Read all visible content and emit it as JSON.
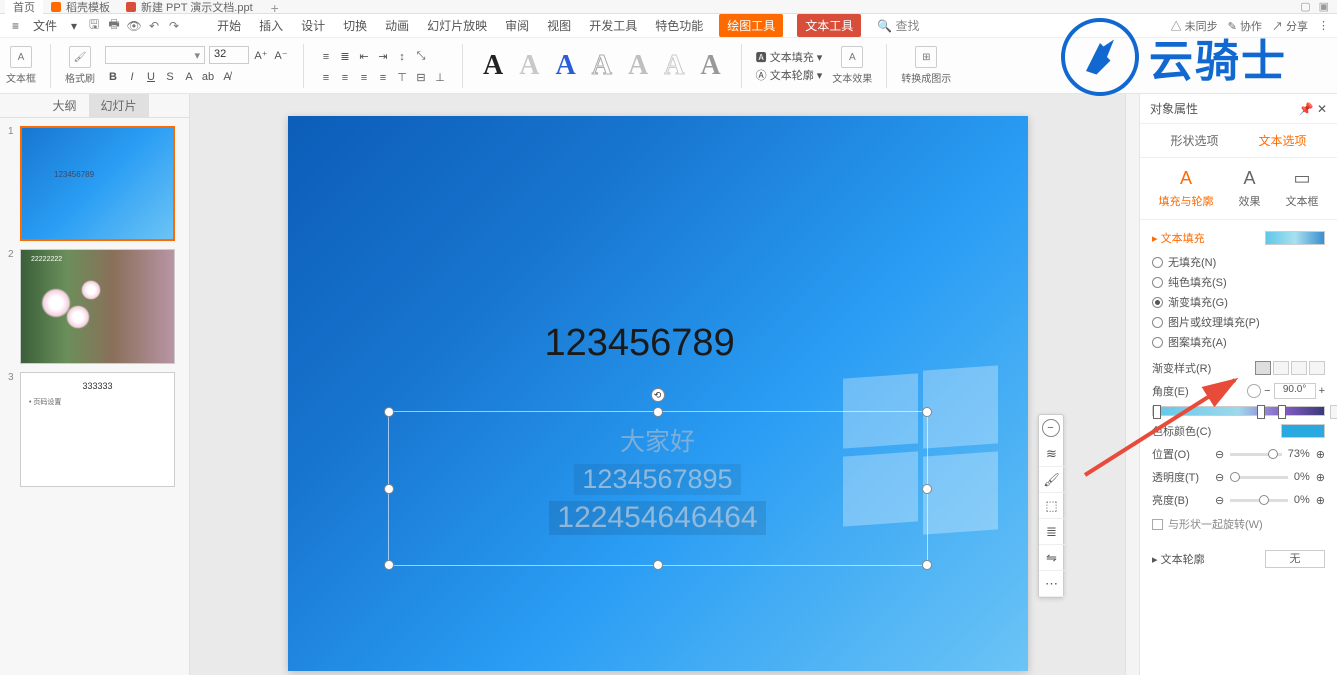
{
  "tabs": {
    "home": "首页",
    "template": "稻壳模板",
    "doc": "新建 PPT 演示文档.ppt"
  },
  "menu": {
    "file": "文件",
    "items": [
      "开始",
      "插入",
      "设计",
      "切换",
      "动画",
      "幻灯片放映",
      "审阅",
      "视图",
      "开发工具",
      "特色功能"
    ],
    "draw_tool": "绘图工具",
    "text_tool": "文本工具",
    "search": "查找",
    "right": {
      "sync": "未同步",
      "collab": "协作",
      "share": "分享"
    }
  },
  "ribbon": {
    "textbox": "文本框",
    "format_painter": "格式刷",
    "font_size": "32",
    "text_fill": "文本填充",
    "text_outline": "文本轮廓",
    "text_effect": "文本效果",
    "convert": "转换成图示"
  },
  "watermark": "云骑士",
  "slide_tabs": {
    "outline": "大纲",
    "slides": "幻灯片"
  },
  "thumbs": {
    "t1_text": "123456789",
    "t3_title": "333333",
    "t3_body": "• 页码设置"
  },
  "canvas": {
    "big_text": "123456789",
    "line1": "大家好",
    "line2": "1234567895",
    "line3": "122454646464"
  },
  "right_panel": {
    "title": "对象属性",
    "tab_shape": "形状选项",
    "tab_text": "文本选项",
    "sub_fill": "填充与轮廓",
    "sub_effect": "效果",
    "sub_textbox": "文本框",
    "section_fill": "文本填充",
    "radios": {
      "none": "无填充(N)",
      "solid": "纯色填充(S)",
      "gradient": "渐变填充(G)",
      "picture": "图片或纹理填充(P)",
      "pattern": "图案填充(A)"
    },
    "grad_style": "渐变样式(R)",
    "angle": "角度(E)",
    "angle_val": "90.0°",
    "stop_color": "色标颜色(C)",
    "position": "位置(O)",
    "position_val": "73%",
    "transparency": "透明度(T)",
    "transparency_val": "0%",
    "brightness": "亮度(B)",
    "brightness_val": "0%",
    "rotate_with": "与形状一起旋转(W)",
    "section_outline": "文本轮廓",
    "outline_none": "无"
  }
}
